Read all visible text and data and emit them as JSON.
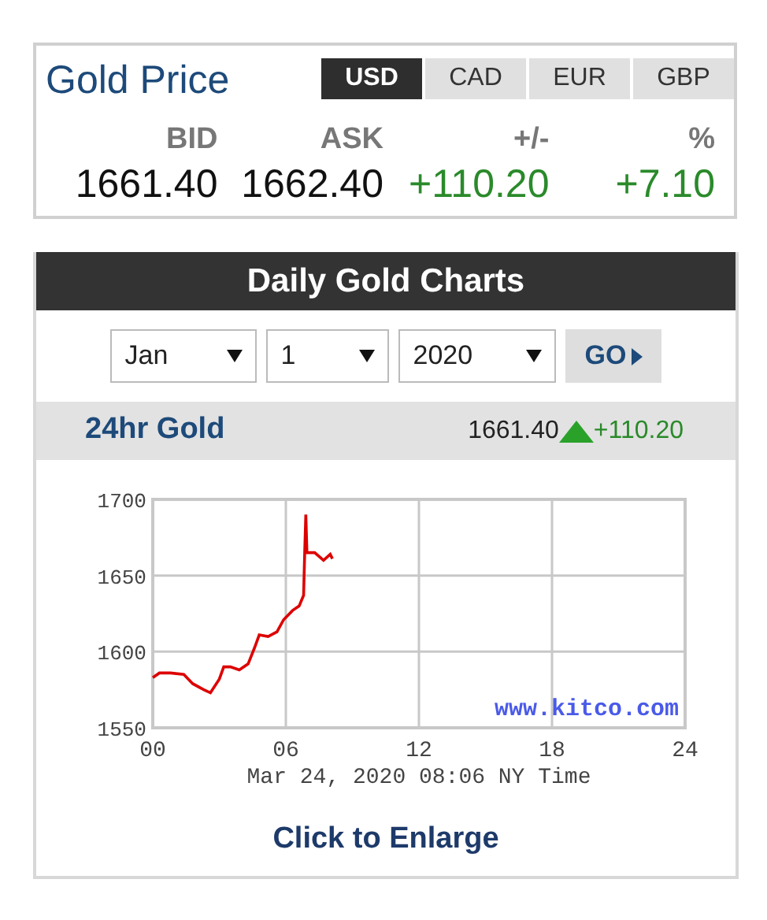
{
  "price_panel": {
    "title": "Gold Price",
    "currency_tabs": [
      {
        "label": "USD",
        "selected": true
      },
      {
        "label": "CAD",
        "selected": false
      },
      {
        "label": "EUR",
        "selected": false
      },
      {
        "label": "GBP",
        "selected": false
      }
    ],
    "columns": [
      {
        "label": "BID",
        "value": "1661.40",
        "kind": "plain"
      },
      {
        "label": "ASK",
        "value": "1662.40",
        "kind": "plain"
      },
      {
        "label": "+/-",
        "value": "+110.20",
        "kind": "gain"
      },
      {
        "label": "%",
        "value": "+7.10",
        "kind": "gain"
      }
    ]
  },
  "charts_panel": {
    "title": "Daily Gold Charts",
    "selects": [
      {
        "value": "Jan"
      },
      {
        "value": "1"
      },
      {
        "value": "2020"
      }
    ],
    "go_button": "GO",
    "ticker": {
      "label": "24hr Gold",
      "price": "1661.40",
      "change": "+110.20",
      "rising": true
    },
    "chart_data": {
      "type": "line",
      "xlabel": "Mar 24, 2020 08:06 NY Time",
      "x": [
        0,
        0.3,
        0.8,
        1.4,
        1.8,
        2.3,
        2.6,
        3.0,
        3.2,
        3.5,
        3.9,
        4.3,
        4.6,
        4.8,
        5.2,
        5.6,
        5.9,
        6.3,
        6.6,
        6.8,
        6.85,
        6.9,
        6.95,
        7.3,
        7.7,
        8.0,
        8.1
      ],
      "series": [
        {
          "color": "#dd0000",
          "values": [
            1583,
            1586,
            1586,
            1585,
            1579,
            1575,
            1573,
            1582,
            1590,
            1590,
            1588,
            1592,
            1603,
            1611,
            1610,
            1613,
            1621,
            1627,
            1630,
            1637,
            1665,
            1690,
            1665,
            1665,
            1660,
            1664,
            1661
          ]
        }
      ],
      "grid": true,
      "xlim": [
        0,
        24
      ],
      "ylim": [
        1550,
        1700
      ],
      "xticks": [
        {
          "value": 0,
          "label": "00"
        },
        {
          "value": 6,
          "label": "06"
        },
        {
          "value": 12,
          "label": "12"
        },
        {
          "value": 18,
          "label": "18"
        },
        {
          "value": 24,
          "label": "24"
        }
      ],
      "yticks": [
        1550,
        1600,
        1650,
        1700
      ],
      "annotations": [
        {
          "text": "www.kitco.com"
        }
      ]
    },
    "enlarge_link": "Click to Enlarge"
  }
}
